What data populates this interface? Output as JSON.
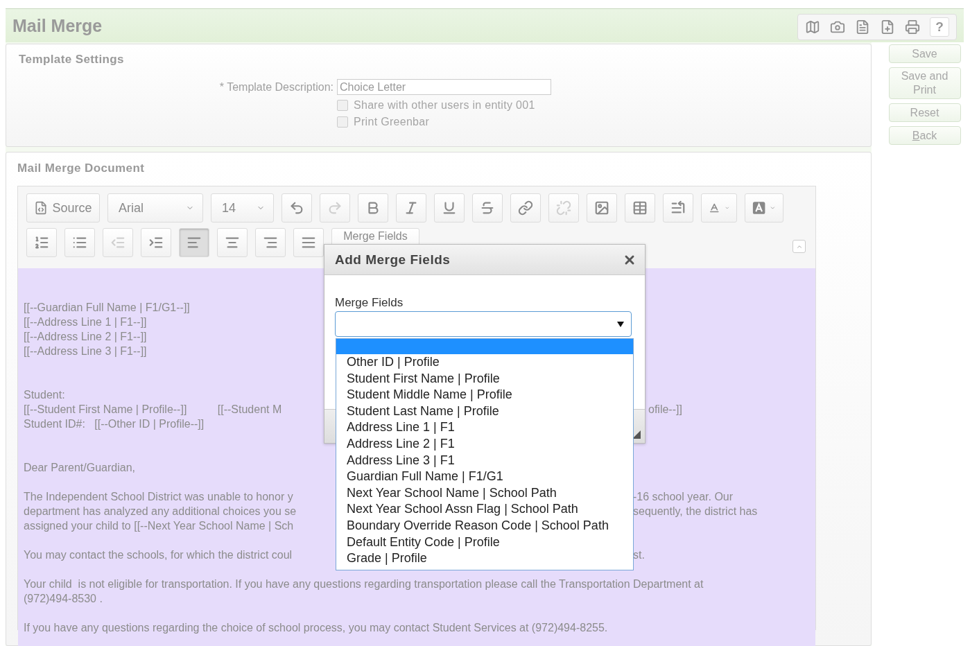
{
  "page": {
    "title": "Mail Merge",
    "tools": [
      {
        "kind": "map"
      },
      {
        "kind": "camera"
      },
      {
        "kind": "document"
      },
      {
        "kind": "new-document"
      },
      {
        "kind": "print"
      },
      {
        "kind": "help",
        "label": "?"
      }
    ]
  },
  "actions": [
    {
      "label": "Save"
    },
    {
      "label": "Save and Print"
    },
    {
      "label": "Reset"
    },
    {
      "label": "Back"
    }
  ],
  "template_settings": {
    "title": "Template Settings",
    "description_label": "* Template Description:",
    "description_value": "Choice Letter",
    "options": [
      {
        "label": "Share with other users in entity 001",
        "checked": false
      },
      {
        "label": "Print Greenbar",
        "checked": false
      }
    ]
  },
  "document": {
    "title": "Mail Merge Document",
    "toolbar": {
      "rows": [
        [
          {
            "kind": "source",
            "label": "Source",
            "disabled": false,
            "pressed": false
          },
          {
            "kind": "font",
            "label": "Arial",
            "disabled": false,
            "pressed": false
          },
          {
            "kind": "size",
            "label": "14",
            "disabled": false,
            "pressed": false
          },
          {
            "kind": "undo",
            "disabled": false,
            "pressed": false
          },
          {
            "kind": "redo",
            "disabled": true,
            "pressed": false
          },
          {
            "kind": "bold",
            "disabled": false,
            "pressed": false
          },
          {
            "kind": "italic",
            "disabled": false,
            "pressed": false
          },
          {
            "kind": "underline",
            "disabled": false,
            "pressed": false
          },
          {
            "kind": "strike",
            "disabled": false,
            "pressed": false
          },
          {
            "kind": "link",
            "disabled": false,
            "pressed": false
          },
          {
            "kind": "unlink",
            "disabled": true,
            "pressed": false
          },
          {
            "kind": "image",
            "disabled": false,
            "pressed": false
          },
          {
            "kind": "table",
            "disabled": false,
            "pressed": false
          },
          {
            "kind": "blocks",
            "disabled": false,
            "pressed": false
          },
          {
            "kind": "text-color",
            "disabled": false,
            "pressed": false
          },
          {
            "kind": "bg-color",
            "disabled": false,
            "pressed": false
          }
        ],
        [
          {
            "kind": "ordered-list",
            "disabled": false,
            "pressed": false
          },
          {
            "kind": "bullet-list",
            "disabled": false,
            "pressed": false
          },
          {
            "kind": "outdent",
            "disabled": true,
            "pressed": false
          },
          {
            "kind": "indent",
            "disabled": false,
            "pressed": false
          },
          {
            "kind": "align-left",
            "disabled": false,
            "pressed": true
          },
          {
            "kind": "align-center",
            "disabled": false,
            "pressed": false
          },
          {
            "kind": "align-right",
            "disabled": false,
            "pressed": false
          },
          {
            "kind": "justify",
            "disabled": false,
            "pressed": false
          },
          {
            "kind": "merge",
            "label": "Merge Fields",
            "disabled": false,
            "pressed": false
          }
        ]
      ]
    },
    "letter": {
      "address_block": [
        {
          "left": "[[--Guardian Full Name | F1/G1--]]"
        },
        {
          "left": "[[--Address Line 1 | F1--]]"
        },
        {
          "left": "[[--Address Line 2 | F1--]]"
        },
        {
          "left": "[[--Address Line 3 | F1--]]"
        }
      ],
      "student_block": [
        {
          "left": "Student:"
        },
        {
          "left": "[[--Student First Name | Profile--]]          [[--Student M",
          "right": "ofile--]]"
        },
        {
          "left": "Student ID#:   [[--Other ID | Profile--]]"
        }
      ],
      "greeting": "Dear Parent/Guardian,",
      "paragraphs": [
        {
          "lines": [
            {
              "left": "The Independent School District was unable to honor y",
              "right": "-16 school year. Our"
            },
            {
              "left": "department has analyzed any additional choices you se",
              "right": "sequently, the district has"
            },
            {
              "left": "assigned your child to [[--Next Year School Name | Sch"
            }
          ]
        },
        {
          "lines": [
            {
              "left": "You may contact the schools, for which the district coul",
              "right": "st."
            }
          ]
        },
        {
          "lines": [
            {
              "left": "Your child  is not eligible for transportation. If you have any questions regarding transportation please call the Transportation Department at"
            },
            {
              "left": "(972)494-8530 ."
            }
          ]
        },
        {
          "lines": [
            {
              "left": "If you have any questions regarding the choice of school process, you may contact Student Services at (972)494-8255."
            }
          ]
        }
      ]
    }
  },
  "dialog": {
    "title": "Add Merge Fields",
    "field_label": "Merge Fields",
    "options": [
      "Other ID | Profile",
      "Student First Name | Profile",
      "Student Middle Name | Profile",
      "Student Last Name | Profile",
      "Address Line 1 | F1",
      "Address Line 2 | F1",
      "Address Line 3 | F1",
      "Guardian Full Name | F1/G1",
      "Next Year School Name | School Path",
      "Next Year School Assn Flag | School Path",
      "Boundary Override Reason Code | School Path",
      "Default Entity Code | Profile",
      "Grade | Profile"
    ]
  }
}
